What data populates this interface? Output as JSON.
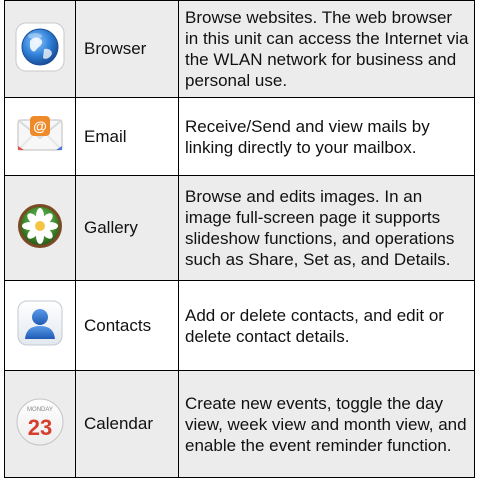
{
  "apps": [
    {
      "name": "Browser",
      "icon": "browser-globe-icon",
      "description": "Browse websites. The web browser in this unit can access the Internet via the WLAN network for business and personal use."
    },
    {
      "name": "Email",
      "icon": "email-envelope-icon",
      "description": "Receive/Send and view mails by linking directly to your mailbox."
    },
    {
      "name": "Gallery",
      "icon": "gallery-flower-icon",
      "description": "Browse and edits images. In an image full-screen page it supports slideshow functions, and operations such as Share, Set as, and Details."
    },
    {
      "name": "Contacts",
      "icon": "contacts-person-icon",
      "description": "Add or delete contacts, and edit or delete contact details."
    },
    {
      "name": "Calendar",
      "icon": "calendar-icon",
      "description": "Create new events, toggle the day view, week view and month view, and enable the event reminder function.",
      "icon_text": {
        "weekday": "MONDAY",
        "day": "23"
      }
    }
  ],
  "colors": {
    "row_shade": "#ececec",
    "border": "#000000",
    "browser_globe": "#2f7fd6",
    "email_at": "#ef8a2a",
    "gallery_green": "#3f8a2c",
    "contacts_blue": "#2f6fc8",
    "calendar_red": "#d63f2c"
  }
}
